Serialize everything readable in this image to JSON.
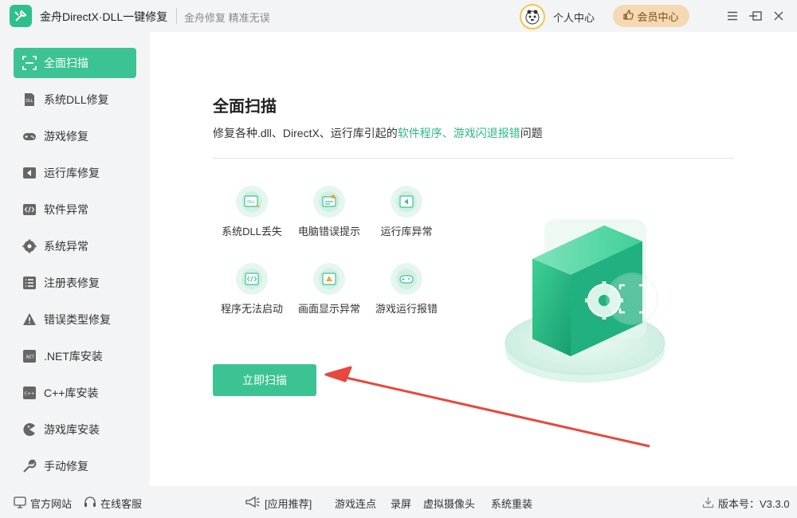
{
  "app": {
    "title": "金舟DirectX·DLL一键修复",
    "slogan": "金舟修复 精准无误",
    "personal_center": "个人中心",
    "vip_label": "会员中心"
  },
  "sidebar": {
    "items": [
      {
        "label": "全面扫描",
        "icon": "scan-icon"
      },
      {
        "label": "系统DLL修复",
        "icon": "dll-icon"
      },
      {
        "label": "游戏修复",
        "icon": "gamepad-icon"
      },
      {
        "label": "运行库修复",
        "icon": "runtime-icon"
      },
      {
        "label": "软件异常",
        "icon": "code-icon"
      },
      {
        "label": "系统异常",
        "icon": "gear-icon"
      },
      {
        "label": "注册表修复",
        "icon": "list-icon"
      },
      {
        "label": "错误类型修复",
        "icon": "warning-icon"
      },
      {
        "label": ".NET库安装",
        "icon": "dotnet-icon"
      },
      {
        "label": "C++库安装",
        "icon": "cpp-icon"
      },
      {
        "label": "游戏库安装",
        "icon": "pacman-icon"
      },
      {
        "label": "手动修复",
        "icon": "wrench-icon"
      }
    ]
  },
  "main": {
    "title": "全面扫描",
    "desc_prefix": "修复各种.dll、DirectX、运行库引起的",
    "desc_highlight": "软件程序、游戏闪退报错",
    "desc_suffix": "问题",
    "features": [
      {
        "label": "系统DLL丢失",
        "icon": "dll-missing-icon"
      },
      {
        "label": "电脑错误提示",
        "icon": "error-prompt-icon"
      },
      {
        "label": "运行库异常",
        "icon": "runtime-error-icon"
      },
      {
        "label": "程序无法启动",
        "icon": "program-start-icon"
      },
      {
        "label": "画面显示异常",
        "icon": "display-error-icon"
      },
      {
        "label": "游戏运行报错",
        "icon": "game-error-icon"
      }
    ],
    "scan_button": "立即扫描"
  },
  "footer": {
    "website": "官方网站",
    "support": "在线客服",
    "recommend": "[应用推荐]",
    "links": [
      "游戏连点",
      "录屏",
      "虚拟摄像头",
      "系统重装"
    ],
    "version": "版本号：V3.3.0"
  },
  "colors": {
    "accent": "#3cc393",
    "highlight_text": "#2fb686",
    "vip_bg": "#f4d9b3",
    "arrow": "#e8473d"
  }
}
